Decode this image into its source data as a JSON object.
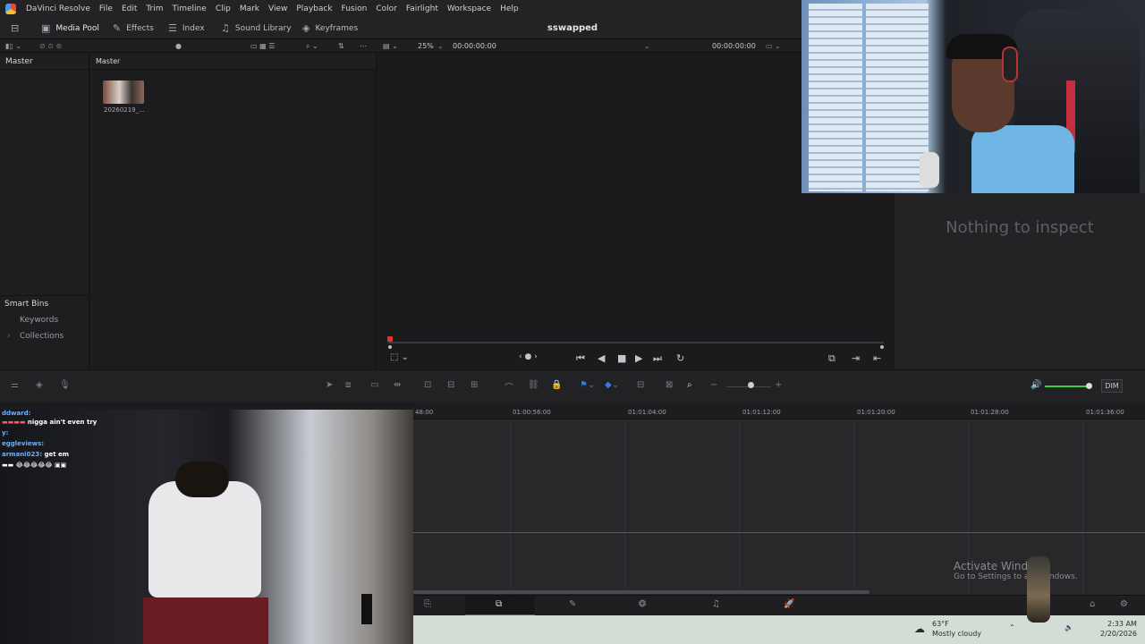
{
  "menubar": {
    "app_name": "DaVinci Resolve",
    "items": [
      "File",
      "Edit",
      "Trim",
      "Timeline",
      "Clip",
      "Mark",
      "View",
      "Playback",
      "Fusion",
      "Color",
      "Fairlight",
      "Workspace",
      "Help"
    ]
  },
  "toolbar": {
    "media_pool": "Media Pool",
    "effects": "Effects",
    "index": "Index",
    "sound_library": "Sound Library",
    "keyframes": "Keyframes",
    "project_title": "sswapped"
  },
  "viewer": {
    "zoom": "25%",
    "source_timecode": "00:00:00:00",
    "timeline_timecode": "00:00:00:00"
  },
  "bins": {
    "master_header": "Master",
    "smart_bins": "Smart Bins",
    "keywords": "Keywords",
    "collections": "Collections"
  },
  "pool": {
    "header": "Master",
    "clip_name": "20260219_..."
  },
  "inspector": {
    "message": "Nothing to inspect"
  },
  "tltools": {
    "dim": "DIM"
  },
  "ruler": {
    "timecodes": [
      "48:00",
      "01:00:56:00",
      "01:01:04:00",
      "01:01:12:00",
      "01:01:20:00",
      "01:01:28:00",
      "01:01:36:00"
    ]
  },
  "chat": [
    {
      "name": "ddward:",
      "msg": ""
    },
    {
      "name": "",
      "msg": "nigga ain't even try"
    },
    {
      "name": "y:",
      "msg": ""
    },
    {
      "name": "eggleviews:",
      "msg": ""
    },
    {
      "name": "armani023:",
      "msg": "get em"
    }
  ],
  "taskbar": {
    "weather_temp": "63°F",
    "weather_desc": "Mostly cloudy",
    "time": "2:33 AM",
    "date": "2/20/2026"
  },
  "watermark": {
    "title": "Activate Windo",
    "subtitle": "Go to Settings to a     e Windows."
  }
}
